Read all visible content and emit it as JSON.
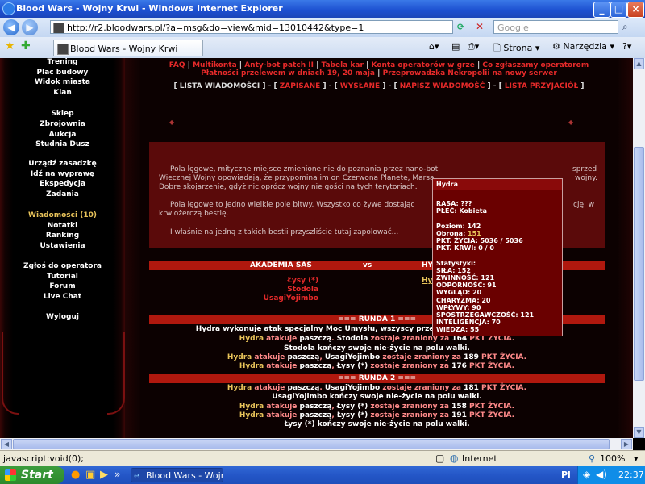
{
  "window": {
    "title": "Blood Wars - Wojny Krwi - Windows Internet Explorer"
  },
  "browser": {
    "url": "http://r2.bloodwars.pl/?a=msg&do=view&mid=13010442&type=1",
    "search_placeholder": "Google",
    "tab_label": "Blood Wars - Wojny Krwi",
    "strona_label": "Strona",
    "narzedzia_label": "Narzędzia"
  },
  "sidebar": {
    "items": [
      "Trening",
      "Plac budowy",
      "Widok miasta",
      "Klan",
      "Sklep",
      "Zbrojownia",
      "Aukcja",
      "Studnia Dusz",
      "Urządź zasadzkę",
      "Idź na wyprawę",
      "Ekspedycja",
      "Zadania",
      "Wiadomości (10)",
      "Notatki",
      "Ranking",
      "Ustawienia",
      "Zgłoś do operatora",
      "Tutorial",
      "Forum",
      "Live Chat",
      "Wyloguj"
    ]
  },
  "top": {
    "links_line1": [
      "FAQ",
      "Multikonta",
      "Anty-bot patch II",
      "Tabela kar",
      "Konta operatorów w grze",
      "Co zgłaszamy operatorom"
    ],
    "links_line2": [
      "Płatności przelewem w dniach 19, 20 maja",
      "Przeprowadzka Nekropolii na nowy serwer"
    ],
    "msg_nav": [
      "LISTA WIADOMOŚCI",
      "ZAPISANE",
      "WYSŁANE",
      "NAPISZ WIADOMOŚĆ",
      "LISTA PRZYJACIÓŁ"
    ]
  },
  "story": {
    "p1_lines": [
      "Pola lęgowe, mityczne miejsce zmienione nie do poznania przez nano-bot",
      "sprzed",
      "Wiecznej Wojny opowiadają, że przypomina im on Czerwoną Planetę, Marsa",
      "wojny.",
      "Dobre skojarzenie, gdyż nic oprócz wojny nie gości na tych terytoriach."
    ],
    "p2_lines": [
      "Pola lęgowe to jedno wielkie pole bitwy. Wszystko co żywe dostając",
      "cję, w",
      "krwiożerczą bestię."
    ],
    "p3": "I właśnie na jedną z takich bestii przyszliście tutaj zapolować..."
  },
  "battle": {
    "team_left": "AKADEMIA SAS",
    "vs": "vs",
    "team_right": "HY",
    "left_members": [
      "Łysy (*)",
      "Stodola",
      "UsagiYojimbo"
    ],
    "right_member": "Hydra",
    "round1": "=== RUNDA 1 ===",
    "r1_special": "Hydra wykonuje atak specjalny Moc Umysłu, wszyscy przeciwnicy zastygają w bezruchu.",
    "r1_lines": [
      {
        "a": "Hydra",
        "b": " atakuje ",
        "c": "paszczą",
        "d": ". ",
        "e": "Stodola",
        "f": " zostaje zraniony za ",
        "g": "164",
        "h": " PKT ŻYCIA."
      },
      {
        "end": "Stodola kończy swoje nie-życie na polu walki."
      },
      {
        "a": "Hydra",
        "b": " atakuje ",
        "c": "paszczą",
        "d": ", ",
        "e": "UsagiYojimbo",
        "f": " zostaje zraniony za ",
        "g": "189",
        "h": " PKT ŻYCIA."
      },
      {
        "a": "Hydra",
        "b": " atakuje ",
        "c": "paszczą",
        "d": ", ",
        "e": "Łysy (*)",
        "f": " zostaje zraniony za ",
        "g": "176",
        "h": " PKT ŻYCIA."
      }
    ],
    "round2": "=== RUNDA 2 ===",
    "r2_lines": [
      {
        "a": "Hydra",
        "b": " atakuje ",
        "c": "paszczą",
        "d": ". ",
        "e": "UsagiYojimbo",
        "f": " zostaje zraniony za ",
        "g": "181",
        "h": " PKT ŻYCIA."
      },
      {
        "end": "UsagiYojimbo kończy swoje nie-życie na polu walki."
      },
      {
        "a": "Hydra",
        "b": " atakuje ",
        "c": "paszczą",
        "d": ", ",
        "e": "Łysy (*)",
        "f": " zostaje zraniony za ",
        "g": "158",
        "h": " PKT ŻYCIA."
      },
      {
        "a": "Hydra",
        "b": " atakuje ",
        "c": "paszczą",
        "d": ", ",
        "e": "Łysy (*)",
        "f": " zostaje zraniony za ",
        "g": "191",
        "h": " PKT ŻYCIA."
      },
      {
        "end": "Łysy (*) kończy swoje nie-życie na polu walki."
      }
    ]
  },
  "tooltip": {
    "title": "Hydra",
    "lines": [
      "RASA: ???",
      "PŁEĆ: Kobieta",
      "",
      "Poziom: 142",
      "Obrona: 151",
      "PKT. ŻYCIA: 5036 / 5036",
      "PKT. KRWI: 0 / 0",
      "",
      "Statystyki:",
      "SIŁA: 152",
      "ZWINNOŚĆ: 121",
      "ODPORNOŚĆ: 91",
      "WYGLĄD: 20",
      "CHARYZMA: 20",
      "WPŁYWY: 90",
      "SPOSTRZEGAWCZOŚĆ: 121",
      "INTELIGENCJA: 70",
      "WIEDZA: 55"
    ]
  },
  "status": {
    "text": "javascript:void(0);",
    "zone": "Internet",
    "zoom": "100%"
  },
  "taskbar": {
    "start": "Start",
    "task": "Blood Wars - Wojny K...",
    "clock": "22:37"
  }
}
